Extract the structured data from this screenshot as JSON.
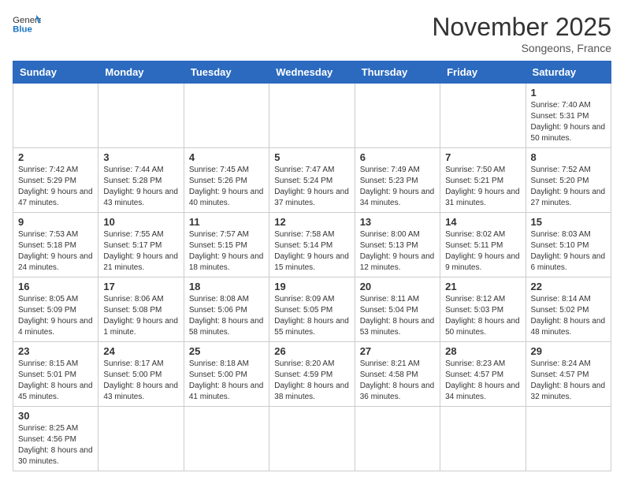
{
  "header": {
    "logo_general": "General",
    "logo_blue": "Blue",
    "month_year": "November 2025",
    "location": "Songeons, France"
  },
  "days_of_week": [
    "Sunday",
    "Monday",
    "Tuesday",
    "Wednesday",
    "Thursday",
    "Friday",
    "Saturday"
  ],
  "weeks": [
    [
      null,
      null,
      null,
      null,
      null,
      null,
      {
        "day": "1",
        "sunrise": "Sunrise: 7:40 AM",
        "sunset": "Sunset: 5:31 PM",
        "daylight": "Daylight: 9 hours and 50 minutes."
      }
    ],
    [
      {
        "day": "2",
        "sunrise": "Sunrise: 7:42 AM",
        "sunset": "Sunset: 5:29 PM",
        "daylight": "Daylight: 9 hours and 47 minutes."
      },
      {
        "day": "3",
        "sunrise": "Sunrise: 7:44 AM",
        "sunset": "Sunset: 5:28 PM",
        "daylight": "Daylight: 9 hours and 43 minutes."
      },
      {
        "day": "4",
        "sunrise": "Sunrise: 7:45 AM",
        "sunset": "Sunset: 5:26 PM",
        "daylight": "Daylight: 9 hours and 40 minutes."
      },
      {
        "day": "5",
        "sunrise": "Sunrise: 7:47 AM",
        "sunset": "Sunset: 5:24 PM",
        "daylight": "Daylight: 9 hours and 37 minutes."
      },
      {
        "day": "6",
        "sunrise": "Sunrise: 7:49 AM",
        "sunset": "Sunset: 5:23 PM",
        "daylight": "Daylight: 9 hours and 34 minutes."
      },
      {
        "day": "7",
        "sunrise": "Sunrise: 7:50 AM",
        "sunset": "Sunset: 5:21 PM",
        "daylight": "Daylight: 9 hours and 31 minutes."
      },
      {
        "day": "8",
        "sunrise": "Sunrise: 7:52 AM",
        "sunset": "Sunset: 5:20 PM",
        "daylight": "Daylight: 9 hours and 27 minutes."
      }
    ],
    [
      {
        "day": "9",
        "sunrise": "Sunrise: 7:53 AM",
        "sunset": "Sunset: 5:18 PM",
        "daylight": "Daylight: 9 hours and 24 minutes."
      },
      {
        "day": "10",
        "sunrise": "Sunrise: 7:55 AM",
        "sunset": "Sunset: 5:17 PM",
        "daylight": "Daylight: 9 hours and 21 minutes."
      },
      {
        "day": "11",
        "sunrise": "Sunrise: 7:57 AM",
        "sunset": "Sunset: 5:15 PM",
        "daylight": "Daylight: 9 hours and 18 minutes."
      },
      {
        "day": "12",
        "sunrise": "Sunrise: 7:58 AM",
        "sunset": "Sunset: 5:14 PM",
        "daylight": "Daylight: 9 hours and 15 minutes."
      },
      {
        "day": "13",
        "sunrise": "Sunrise: 8:00 AM",
        "sunset": "Sunset: 5:13 PM",
        "daylight": "Daylight: 9 hours and 12 minutes."
      },
      {
        "day": "14",
        "sunrise": "Sunrise: 8:02 AM",
        "sunset": "Sunset: 5:11 PM",
        "daylight": "Daylight: 9 hours and 9 minutes."
      },
      {
        "day": "15",
        "sunrise": "Sunrise: 8:03 AM",
        "sunset": "Sunset: 5:10 PM",
        "daylight": "Daylight: 9 hours and 6 minutes."
      }
    ],
    [
      {
        "day": "16",
        "sunrise": "Sunrise: 8:05 AM",
        "sunset": "Sunset: 5:09 PM",
        "daylight": "Daylight: 9 hours and 4 minutes."
      },
      {
        "day": "17",
        "sunrise": "Sunrise: 8:06 AM",
        "sunset": "Sunset: 5:08 PM",
        "daylight": "Daylight: 9 hours and 1 minute."
      },
      {
        "day": "18",
        "sunrise": "Sunrise: 8:08 AM",
        "sunset": "Sunset: 5:06 PM",
        "daylight": "Daylight: 8 hours and 58 minutes."
      },
      {
        "day": "19",
        "sunrise": "Sunrise: 8:09 AM",
        "sunset": "Sunset: 5:05 PM",
        "daylight": "Daylight: 8 hours and 55 minutes."
      },
      {
        "day": "20",
        "sunrise": "Sunrise: 8:11 AM",
        "sunset": "Sunset: 5:04 PM",
        "daylight": "Daylight: 8 hours and 53 minutes."
      },
      {
        "day": "21",
        "sunrise": "Sunrise: 8:12 AM",
        "sunset": "Sunset: 5:03 PM",
        "daylight": "Daylight: 8 hours and 50 minutes."
      },
      {
        "day": "22",
        "sunrise": "Sunrise: 8:14 AM",
        "sunset": "Sunset: 5:02 PM",
        "daylight": "Daylight: 8 hours and 48 minutes."
      }
    ],
    [
      {
        "day": "23",
        "sunrise": "Sunrise: 8:15 AM",
        "sunset": "Sunset: 5:01 PM",
        "daylight": "Daylight: 8 hours and 45 minutes."
      },
      {
        "day": "24",
        "sunrise": "Sunrise: 8:17 AM",
        "sunset": "Sunset: 5:00 PM",
        "daylight": "Daylight: 8 hours and 43 minutes."
      },
      {
        "day": "25",
        "sunrise": "Sunrise: 8:18 AM",
        "sunset": "Sunset: 5:00 PM",
        "daylight": "Daylight: 8 hours and 41 minutes."
      },
      {
        "day": "26",
        "sunrise": "Sunrise: 8:20 AM",
        "sunset": "Sunset: 4:59 PM",
        "daylight": "Daylight: 8 hours and 38 minutes."
      },
      {
        "day": "27",
        "sunrise": "Sunrise: 8:21 AM",
        "sunset": "Sunset: 4:58 PM",
        "daylight": "Daylight: 8 hours and 36 minutes."
      },
      {
        "day": "28",
        "sunrise": "Sunrise: 8:23 AM",
        "sunset": "Sunset: 4:57 PM",
        "daylight": "Daylight: 8 hours and 34 minutes."
      },
      {
        "day": "29",
        "sunrise": "Sunrise: 8:24 AM",
        "sunset": "Sunset: 4:57 PM",
        "daylight": "Daylight: 8 hours and 32 minutes."
      }
    ],
    [
      {
        "day": "30",
        "sunrise": "Sunrise: 8:25 AM",
        "sunset": "Sunset: 4:56 PM",
        "daylight": "Daylight: 8 hours and 30 minutes."
      },
      null,
      null,
      null,
      null,
      null,
      null
    ]
  ]
}
